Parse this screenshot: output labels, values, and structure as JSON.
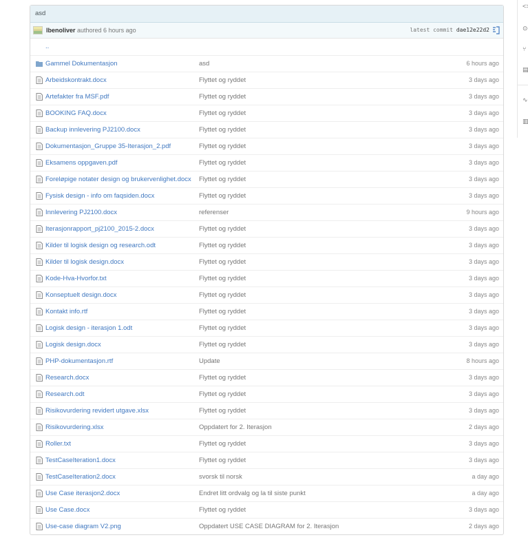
{
  "commit": {
    "message": "asd",
    "author": "lbenoliver",
    "authored_text": "authored 6 hours ago",
    "latest_commit_label": "latest commit",
    "sha": "dae12e22d2"
  },
  "parent_dir": "..",
  "files": [
    {
      "type": "folder",
      "name": "Gammel Dokumentasjon",
      "message": "asd",
      "age": "6 hours ago"
    },
    {
      "type": "file",
      "name": "Arbeidskontrakt.docx",
      "message": "Flyttet og ryddet",
      "age": "3 days ago"
    },
    {
      "type": "file",
      "name": "Artefakter fra MSF.pdf",
      "message": "Flyttet og ryddet",
      "age": "3 days ago"
    },
    {
      "type": "file",
      "name": "BOOKING FAQ.docx",
      "message": "Flyttet og ryddet",
      "age": "3 days ago"
    },
    {
      "type": "file",
      "name": "Backup innlevering PJ2100.docx",
      "message": "Flyttet og ryddet",
      "age": "3 days ago"
    },
    {
      "type": "file",
      "name": "Dokumentasjon_Gruppe 35-Iterasjon_2.pdf",
      "message": "Flyttet og ryddet",
      "age": "3 days ago"
    },
    {
      "type": "file",
      "name": "Eksamens oppgaven.pdf",
      "message": "Flyttet og ryddet",
      "age": "3 days ago"
    },
    {
      "type": "file",
      "name": "Foreløpige notater design og brukervenlighet.docx",
      "message": "Flyttet og ryddet",
      "age": "3 days ago"
    },
    {
      "type": "file",
      "name": "Fysisk design - info om faqsiden.docx",
      "message": "Flyttet og ryddet",
      "age": "3 days ago"
    },
    {
      "type": "file",
      "name": "Innlevering PJ2100.docx",
      "message": "referenser",
      "age": "9 hours ago"
    },
    {
      "type": "file",
      "name": "Iterasjonrapport_pj2100_2015-2.docx",
      "message": "Flyttet og ryddet",
      "age": "3 days ago"
    },
    {
      "type": "file",
      "name": "Kilder til logisk design og research.odt",
      "message": "Flyttet og ryddet",
      "age": "3 days ago"
    },
    {
      "type": "file",
      "name": "Kilder til logisk design.docx",
      "message": "Flyttet og ryddet",
      "age": "3 days ago"
    },
    {
      "type": "file",
      "name": "Kode-Hva-Hvorfor.txt",
      "message": "Flyttet og ryddet",
      "age": "3 days ago"
    },
    {
      "type": "file",
      "name": "Konseptuelt design.docx",
      "message": "Flyttet og ryddet",
      "age": "3 days ago"
    },
    {
      "type": "file",
      "name": "Kontakt info.rtf",
      "message": "Flyttet og ryddet",
      "age": "3 days ago"
    },
    {
      "type": "file",
      "name": "Logisk design - iterasjon 1.odt",
      "message": "Flyttet og ryddet",
      "age": "3 days ago"
    },
    {
      "type": "file",
      "name": "Logisk design.docx",
      "message": "Flyttet og ryddet",
      "age": "3 days ago"
    },
    {
      "type": "file",
      "name": "PHP-dokumentasjon.rtf",
      "message": "Update",
      "age": "8 hours ago"
    },
    {
      "type": "file",
      "name": "Research.docx",
      "message": "Flyttet og ryddet",
      "age": "3 days ago"
    },
    {
      "type": "file",
      "name": "Research.odt",
      "message": "Flyttet og ryddet",
      "age": "3 days ago"
    },
    {
      "type": "file",
      "name": "Risikovurdering revidert utgave.xlsx",
      "message": "Flyttet og ryddet",
      "age": "3 days ago"
    },
    {
      "type": "file",
      "name": "Risikovurdering.xlsx",
      "message": "Oppdatert for 2. Iterasjon",
      "age": "2 days ago"
    },
    {
      "type": "file",
      "name": "Roller.txt",
      "message": "Flyttet og ryddet",
      "age": "3 days ago"
    },
    {
      "type": "file",
      "name": "TestCaseIteration1.docx",
      "message": "Flyttet og ryddet",
      "age": "3 days ago"
    },
    {
      "type": "file",
      "name": "TestCaseIteration2.docx",
      "message": "svorsk til norsk",
      "age": "a day ago"
    },
    {
      "type": "file",
      "name": "Use Case iterasjon2.docx",
      "message": "Endret litt ordvalg og la til siste punkt",
      "age": "a day ago"
    },
    {
      "type": "file",
      "name": "Use Case.docx",
      "message": "Flyttet og ryddet",
      "age": "3 days ago"
    },
    {
      "type": "file",
      "name": "Use-case diagram V2.png",
      "message": "Oppdatert USE CASE DIAGRAM for 2. Iterasjon",
      "age": "2 days ago"
    }
  ],
  "colors": {
    "link": "#4078c0",
    "commit_header_bg": "#e6f1f6",
    "folder_icon": "#80a6cd"
  },
  "sidebar_icons": [
    "code-icon",
    "issue-icon",
    "pull-request-icon",
    "wiki-icon",
    "pulse-icon",
    "graph-icon"
  ]
}
